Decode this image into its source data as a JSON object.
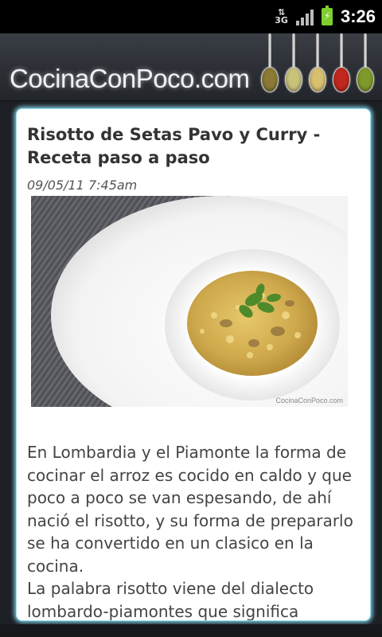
{
  "status_bar": {
    "network": "3G",
    "time": "3:26",
    "icons": [
      "3g-icon",
      "signal-icon",
      "battery-charging-icon"
    ]
  },
  "header": {
    "site_title": "CocinaConPoco.com",
    "spoon_colors": [
      "#8a7a36",
      "#c8c27a",
      "#d8c070",
      "#c0281e",
      "#7f9a2a"
    ]
  },
  "article": {
    "title": "Risotto de Setas Pavo y Curry - Receta paso a paso",
    "date": "09/05/11 7:45am",
    "image": {
      "watermark": "CocinaConPoco.com",
      "description_icon": "risotto-photo"
    },
    "paragraphs": [
      "En Lombardia y el Piamonte la forma de cocinar el arroz es cocido en caldo y que poco a poco se van espesando, de ahí nació el risotto, y su forma de prepararlo se ha convertido en un clasico en la cocina.",
      "La palabra risotto viene del dialecto lombardo-piamontes que significa"
    ]
  },
  "colors": {
    "accent_glow": "#7fd3e6",
    "background": "#1c1f24"
  }
}
